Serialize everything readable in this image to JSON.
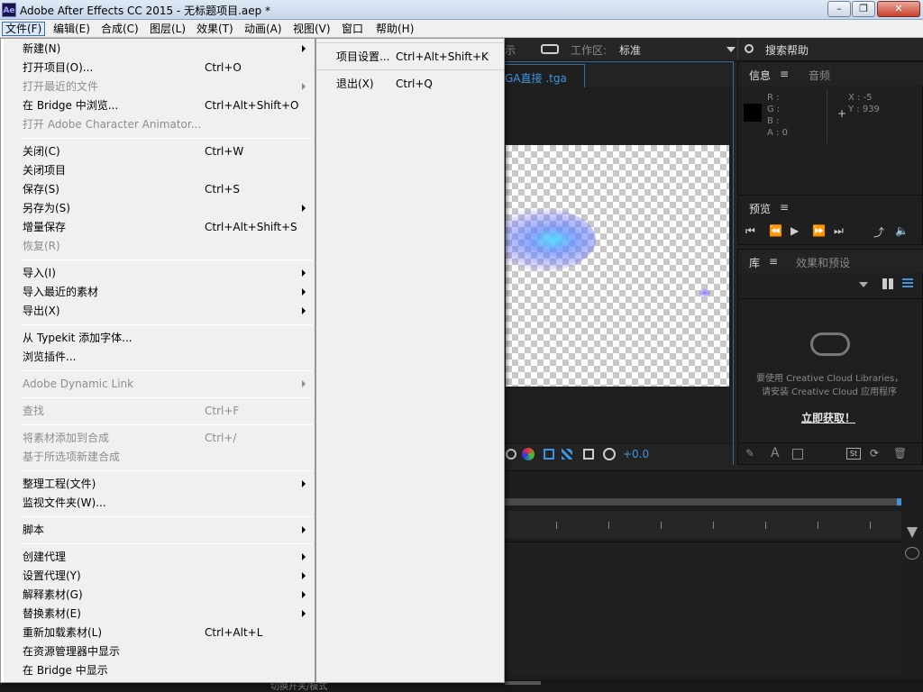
{
  "window": {
    "app_icon": "Ae",
    "title": "Adobe After Effects CC 2015 - 无标题项目.aep *",
    "minimize": "–",
    "restore": "❐",
    "close": "✕"
  },
  "menubar": [
    "文件(F)",
    "编辑(E)",
    "合成(C)",
    "图层(L)",
    "效果(T)",
    "动画(A)",
    "视图(V)",
    "窗口",
    "帮助(H)"
  ],
  "toolbar": {
    "partial_label": "示",
    "workspace_label": "工作区:",
    "workspace_value": "标准",
    "search_help": "搜索帮助"
  },
  "comp_tab": {
    "label": "GA直接 .tga"
  },
  "viewer_footer": {
    "exposure": "+0.0"
  },
  "info_panel": {
    "tab_info": "信息",
    "tab_audio": "音频",
    "r": "R :",
    "g": "G :",
    "b": "B :",
    "a": "A : 0",
    "x": "X : -5",
    "y": "Y : 939"
  },
  "preview_panel": {
    "tab": "预览"
  },
  "library_panel": {
    "tab_library": "库",
    "tab_effects": "效果和预设",
    "message_line1": "要使用 Creative Cloud Libraries，",
    "message_line2": "请安装 Creative Cloud 应用程序",
    "get_now": "立即获取！"
  },
  "status_bar": {
    "toggle_label": "切换开关/模式"
  },
  "file_menu": {
    "items": [
      {
        "label": "新建(N)",
        "shortcut": "",
        "submenu": true,
        "disabled": false
      },
      {
        "label": "打开项目(O)...",
        "shortcut": "Ctrl+O",
        "submenu": false,
        "disabled": false
      },
      {
        "label": "打开最近的文件",
        "shortcut": "",
        "submenu": true,
        "disabled": true
      },
      {
        "label": "在 Bridge 中浏览...",
        "shortcut": "Ctrl+Alt+Shift+O",
        "submenu": false,
        "disabled": false
      },
      {
        "label": "打开 Adobe Character Animator...",
        "shortcut": "",
        "submenu": false,
        "disabled": true
      },
      {
        "label": "关闭(C)",
        "shortcut": "Ctrl+W",
        "submenu": false,
        "disabled": false
      },
      {
        "label": "关闭项目",
        "shortcut": "",
        "submenu": false,
        "disabled": false
      },
      {
        "label": "保存(S)",
        "shortcut": "Ctrl+S",
        "submenu": false,
        "disabled": false
      },
      {
        "label": "另存为(S)",
        "shortcut": "",
        "submenu": true,
        "disabled": false
      },
      {
        "label": "增量保存",
        "shortcut": "Ctrl+Alt+Shift+S",
        "submenu": false,
        "disabled": false
      },
      {
        "label": "恢复(R)",
        "shortcut": "",
        "submenu": false,
        "disabled": true
      },
      {
        "label": "导入(I)",
        "shortcut": "",
        "submenu": true,
        "disabled": false
      },
      {
        "label": "导入最近的素材",
        "shortcut": "",
        "submenu": true,
        "disabled": false
      },
      {
        "label": "导出(X)",
        "shortcut": "",
        "submenu": true,
        "disabled": false
      },
      {
        "label": "从 Typekit 添加字体...",
        "shortcut": "",
        "submenu": false,
        "disabled": false
      },
      {
        "label": "浏览插件...",
        "shortcut": "",
        "submenu": false,
        "disabled": false
      },
      {
        "label": "Adobe Dynamic Link",
        "shortcut": "",
        "submenu": true,
        "disabled": true
      },
      {
        "label": "查找",
        "shortcut": "Ctrl+F",
        "submenu": false,
        "disabled": true
      },
      {
        "label": "将素材添加到合成",
        "shortcut": "Ctrl+/",
        "submenu": false,
        "disabled": true
      },
      {
        "label": "基于所选项新建合成",
        "shortcut": "",
        "submenu": false,
        "disabled": true
      },
      {
        "label": "整理工程(文件)",
        "shortcut": "",
        "submenu": true,
        "disabled": false
      },
      {
        "label": "监视文件夹(W)...",
        "shortcut": "",
        "submenu": false,
        "disabled": false
      },
      {
        "label": "脚本",
        "shortcut": "",
        "submenu": true,
        "disabled": false
      },
      {
        "label": "创建代理",
        "shortcut": "",
        "submenu": true,
        "disabled": false
      },
      {
        "label": "设置代理(Y)",
        "shortcut": "",
        "submenu": true,
        "disabled": false
      },
      {
        "label": "解释素材(G)",
        "shortcut": "",
        "submenu": true,
        "disabled": false
      },
      {
        "label": "替换素材(E)",
        "shortcut": "",
        "submenu": true,
        "disabled": false
      },
      {
        "label": "重新加载素材(L)",
        "shortcut": "Ctrl+Alt+L",
        "submenu": false,
        "disabled": false
      },
      {
        "label": "在资源管理器中显示",
        "shortcut": "",
        "submenu": false,
        "disabled": false
      },
      {
        "label": "在 Bridge 中显示",
        "shortcut": "",
        "submenu": false,
        "disabled": false
      }
    ]
  },
  "sub_menu": {
    "items": [
      {
        "label": "项目设置...",
        "shortcut": "Ctrl+Alt+Shift+K"
      },
      {
        "label": "退出(X)",
        "shortcut": "Ctrl+Q"
      }
    ]
  }
}
